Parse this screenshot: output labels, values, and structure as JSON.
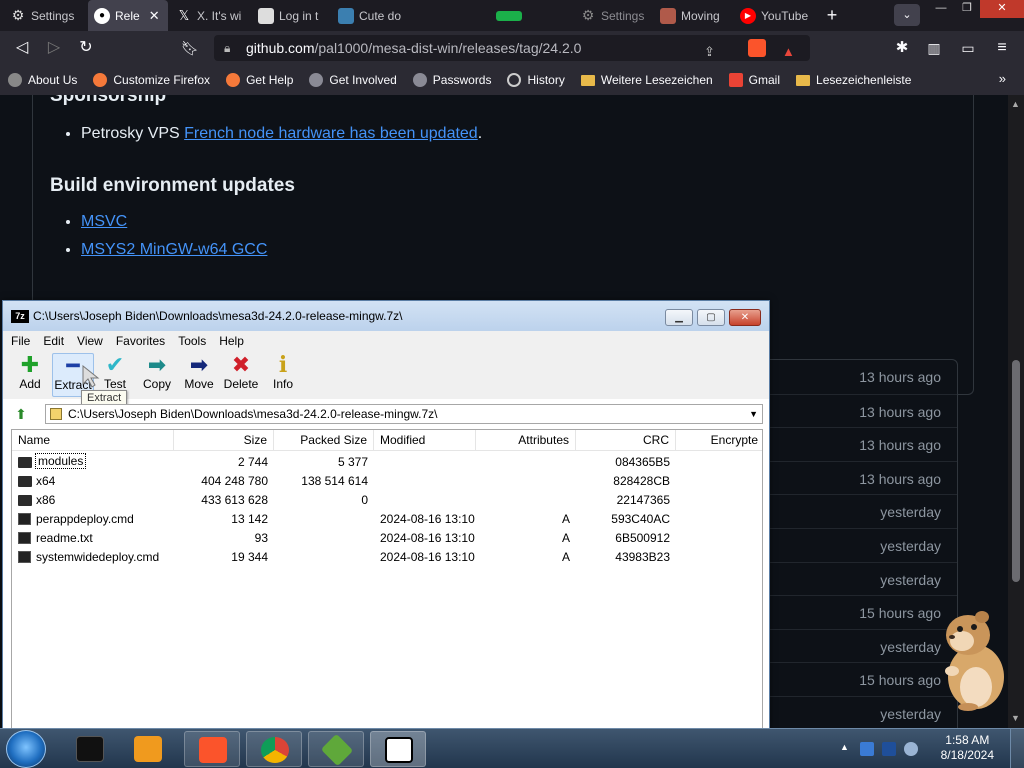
{
  "browser": {
    "tabs": [
      {
        "label": "Settings",
        "icon": "gear-icon",
        "active": false
      },
      {
        "label": "Rele",
        "icon": "github-icon",
        "active": true
      },
      {
        "label": "X. It's wi",
        "icon": "x-icon",
        "active": false
      },
      {
        "label": "Log in t",
        "icon": "login-icon",
        "active": false
      },
      {
        "label": "Cute do",
        "icon": "image-icon",
        "active": false
      },
      {
        "label": "Settings",
        "icon": "gear-icon",
        "active": false
      },
      {
        "label": "Moving",
        "icon": "image-icon",
        "active": false
      },
      {
        "label": "YouTube",
        "icon": "youtube-icon",
        "active": false
      }
    ],
    "url_host": "github.com",
    "url_path": "/pal1000/mesa-dist-win/releases/tag/24.2.0",
    "bookmarks": [
      {
        "label": "About Us",
        "icon": "firefox-icon"
      },
      {
        "label": "Customize Firefox",
        "icon": "firefox-icon"
      },
      {
        "label": "Get Help",
        "icon": "firefox-icon"
      },
      {
        "label": "Get Involved",
        "icon": "globe-icon"
      },
      {
        "label": "Passwords",
        "icon": "globe-icon"
      },
      {
        "label": "History",
        "icon": "history-icon"
      },
      {
        "label": "Weitere Lesezeichen",
        "icon": "folder-icon"
      },
      {
        "label": "Gmail",
        "icon": "gmail-icon"
      },
      {
        "label": "Lesezeichenleiste",
        "icon": "folder-icon"
      }
    ]
  },
  "github": {
    "heading_partial": "Sponsorship",
    "sponsor_prefix": "Petrosky VPS ",
    "sponsor_link": "French node hardware has been updated",
    "sponsor_suffix": ".",
    "build_heading": "Build environment updates",
    "build_links": [
      "MSVC",
      "MSYS2 MinGW-w64 GCC"
    ],
    "asset_times": [
      "13 hours ago",
      "13 hours ago",
      "13 hours ago",
      "13 hours ago",
      "yesterday",
      "yesterday",
      "yesterday",
      "15 hours ago",
      "yesterday",
      "15 hours ago",
      "yesterday"
    ]
  },
  "sevenzip": {
    "title": "C:\\Users\\Joseph Biden\\Downloads\\mesa3d-24.2.0-release-mingw.7z\\",
    "app_icon_text": "7z",
    "menu": [
      "File",
      "Edit",
      "View",
      "Favorites",
      "Tools",
      "Help"
    ],
    "toolbar": [
      {
        "label": "Add",
        "glyph": "✚",
        "color": "#1fa12a"
      },
      {
        "label": "Extract",
        "glyph": "━",
        "color": "#1d3fa6"
      },
      {
        "label": "Test",
        "glyph": "✔",
        "color": "#2fb7c9"
      },
      {
        "label": "Copy",
        "glyph": "➡",
        "color": "#1d8a8a"
      },
      {
        "label": "Move",
        "glyph": "➡",
        "color": "#14287a"
      },
      {
        "label": "Delete",
        "glyph": "✖",
        "color": "#d0202a"
      },
      {
        "label": "Info",
        "glyph": "i",
        "color": "#c9a21a"
      }
    ],
    "tooltip": "Extract",
    "address": "C:\\Users\\Joseph Biden\\Downloads\\mesa3d-24.2.0-release-mingw.7z\\",
    "columns": [
      "Name",
      "Size",
      "Packed Size",
      "Modified",
      "Attributes",
      "CRC",
      "Encrypte"
    ],
    "files": [
      {
        "name": "modules",
        "size": "2 744",
        "packed": "5 377",
        "modified": "",
        "attributes": "",
        "crc": "084365B5",
        "type": "folder"
      },
      {
        "name": "x64",
        "size": "404 248 780",
        "packed": "138 514 614",
        "modified": "",
        "attributes": "",
        "crc": "828428CB",
        "type": "folder"
      },
      {
        "name": "x86",
        "size": "433 613 628",
        "packed": "0",
        "modified": "",
        "attributes": "",
        "crc": "22147365",
        "type": "folder"
      },
      {
        "name": "perappdeploy.cmd",
        "size": "13 142",
        "packed": "",
        "modified": "2024-08-16 13:10",
        "attributes": "A",
        "crc": "593C40AC",
        "type": "file"
      },
      {
        "name": "readme.txt",
        "size": "93",
        "packed": "",
        "modified": "2024-08-16 13:10",
        "attributes": "A",
        "crc": "6B500912",
        "type": "file"
      },
      {
        "name": "systemwidedeploy.cmd",
        "size": "19 344",
        "packed": "",
        "modified": "2024-08-16 13:10",
        "attributes": "A",
        "crc": "43983B23",
        "type": "file"
      }
    ]
  },
  "taskbar": {
    "clock_time": "1:58 AM",
    "clock_date": "8/18/2024",
    "apps": [
      "explorer-icon",
      "media-player-icon",
      "brave-icon",
      "chrome-icon",
      "minecraft-icon",
      "7zip-icon"
    ]
  }
}
